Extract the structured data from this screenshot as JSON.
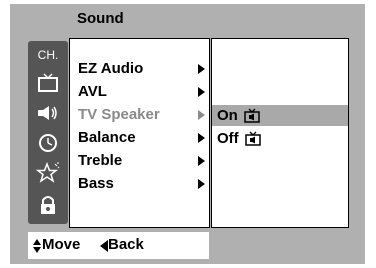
{
  "menu": {
    "title": "Sound",
    "items": [
      {
        "label": "EZ Audio"
      },
      {
        "label": "AVL"
      },
      {
        "label": "TV Speaker"
      },
      {
        "label": "Balance"
      },
      {
        "label": "Treble"
      },
      {
        "label": "Bass"
      }
    ]
  },
  "side_icons": [
    "ch-icon",
    "tv-icon",
    "speaker-icon",
    "clock-icon",
    "star-icon",
    "lock-icon"
  ],
  "side_ch_label": "CH.",
  "submenu": {
    "options": [
      {
        "label": "On",
        "icon": "tv-speaker-icon"
      },
      {
        "label": "Off",
        "icon": "tv-speaker-icon"
      }
    ]
  },
  "footer": {
    "move": "Move",
    "back": "Back"
  },
  "colors": {
    "frame": "#b0b0b0",
    "sidebar": "#555555",
    "highlight": "#a9a9a9",
    "disabled_text": "#8a8a8a"
  }
}
